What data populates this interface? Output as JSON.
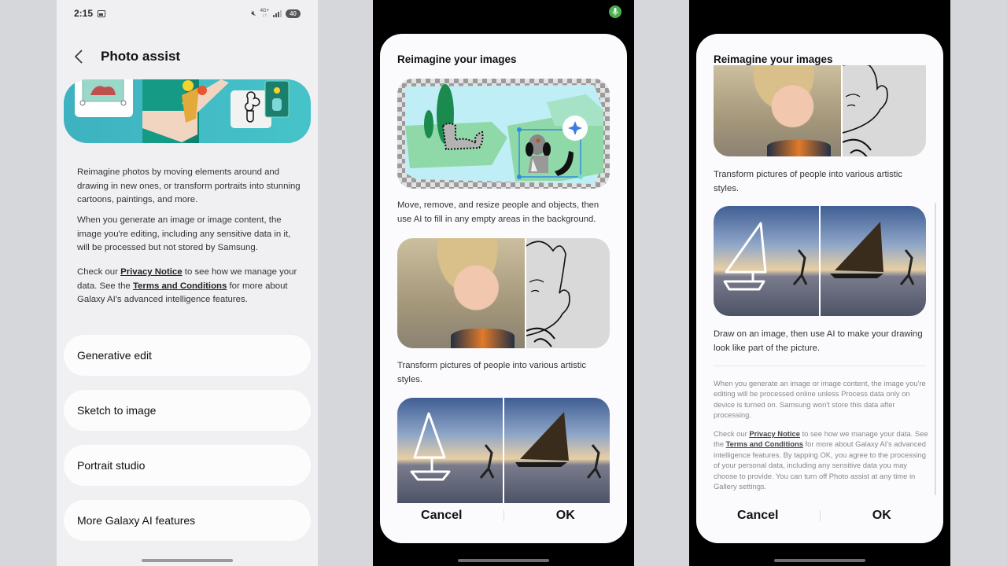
{
  "screen1": {
    "status_bar": {
      "time": "2:15",
      "icons": [
        "gallery-notification-icon",
        "mute-icon",
        "4g-plus-network-icon",
        "signal-icon"
      ],
      "battery": "40"
    },
    "header": {
      "back_icon": "chevron-left-icon",
      "title": "Photo assist"
    },
    "banner": {
      "description": "Illustration of person holding flowers with drawing of flower vase"
    },
    "description": {
      "paragraph1": "Reimagine photos by moving elements around and drawing in new ones, or transform portraits into stunning cartoons, paintings, and more.",
      "paragraph2": "When you generate an image or image content, the image you're editing, including any sensitive data in it, will be processed but not stored by Samsung.",
      "paragraph3_pre": "Check our ",
      "privacy_link": "Privacy Notice",
      "paragraph3_mid": " to see how we manage your data. See the ",
      "terms_link": "Terms and Conditions",
      "paragraph3_post": " for more about Galaxy AI's advanced intelligence features."
    },
    "menu_items": [
      {
        "label": "Generative edit"
      },
      {
        "label": "Sketch to image"
      },
      {
        "label": "Portrait studio"
      },
      {
        "label": "More Galaxy AI features"
      }
    ]
  },
  "screen2": {
    "mic_indicator": "mic-icon",
    "dialog": {
      "title": "Reimagine your images",
      "items": [
        {
          "caption": "Move, remove, and resize people and objects, then use AI to fill in any empty areas in the background."
        },
        {
          "caption": "Transform pictures of people into various artistic styles."
        },
        {
          "caption": ""
        }
      ],
      "cancel_label": "Cancel",
      "ok_label": "OK"
    }
  },
  "screen3": {
    "dialog": {
      "title": "Reimagine your images",
      "items": [
        {
          "caption": "Transform pictures of people into various artistic styles."
        },
        {
          "caption": "Draw on an image, then use AI to make your drawing look like part of the picture."
        }
      ],
      "notice1": "When you generate an image or image content, the image you're editing will be processed online unless Process data only on device is turned on. Samsung won't store this data after processing.",
      "notice2_pre": "Check our ",
      "privacy_link": "Privacy Notice",
      "notice2_mid": " to see how we manage your data. See the ",
      "terms_link": "Terms and Conditions",
      "notice2_post": " for more about Galaxy AI's advanced intelligence features. By tapping OK, you agree to the processing of your personal data, including any sensitive data you may choose to provide. You can turn off Photo assist at any time in Gallery settings.",
      "cancel_label": "Cancel",
      "ok_label": "OK"
    }
  },
  "colors": {
    "banner_teal": "#46c3c9",
    "mic_green": "#4caf50",
    "selection_blue": "#2f8de4"
  }
}
